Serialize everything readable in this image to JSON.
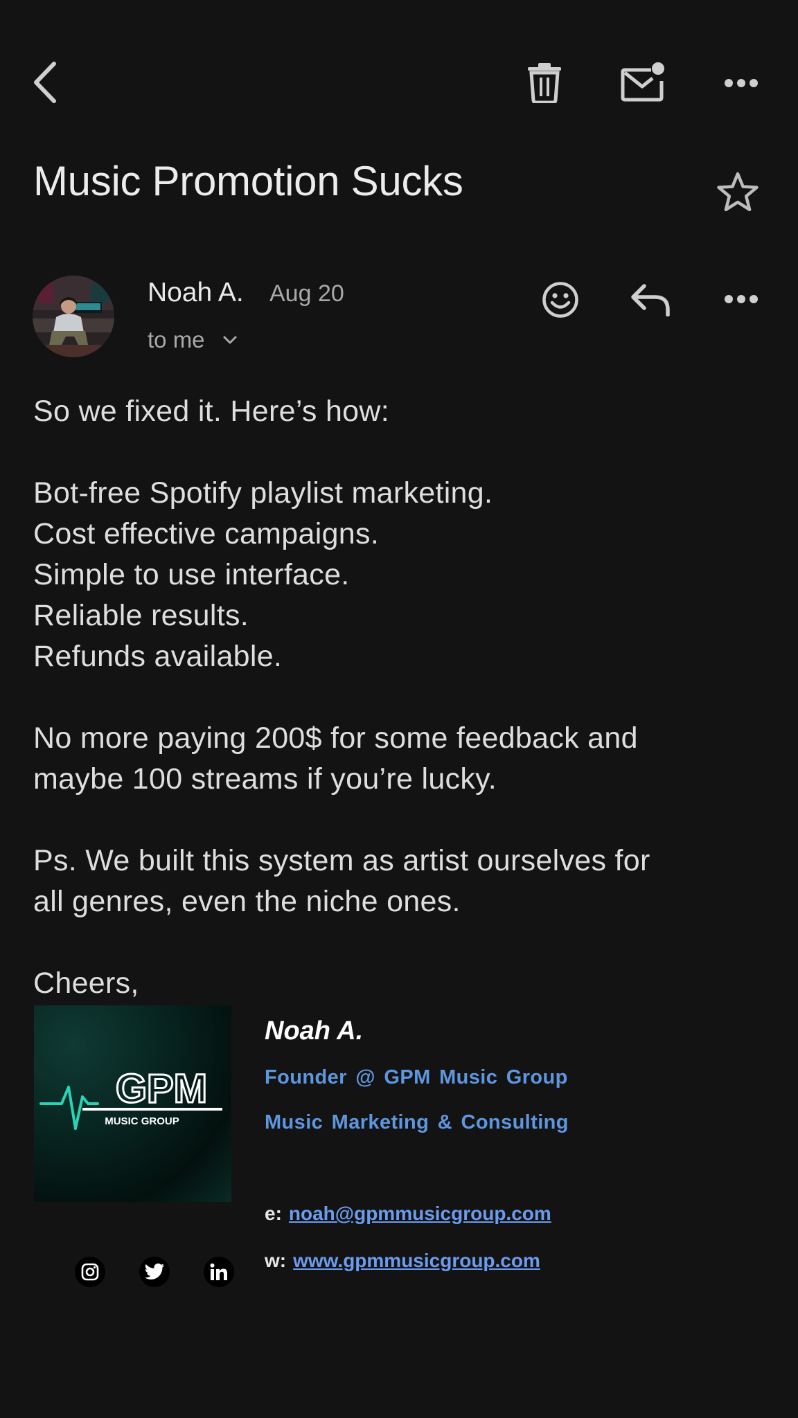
{
  "email": {
    "subject": "Music Promotion Sucks",
    "sender": {
      "name": "Noah A.",
      "date": "Aug 20",
      "recipient_label": "to me"
    },
    "body": {
      "intro": "So we fixed it. Here’s how:",
      "points": [
        "Bot-free Spotify playlist marketing.",
        "Cost effective campaigns.",
        "Simple to use interface.",
        "Reliable results.",
        "Refunds available."
      ],
      "para2_line1": "No more paying 200$ for some feedback and",
      "para2_line2": "maybe 100 streams if you’re lucky.",
      "para3_line1": "Ps. We built this system as artist ourselves for",
      "para3_line2": "all genres, even the niche ones.",
      "signoff": "Cheers,"
    },
    "signature": {
      "logo_main": "GPM",
      "logo_sub": "MUSIC GROUP",
      "name": "Noah A.",
      "title": "Founder @ GPM Music Group",
      "tagline": "Music Marketing & Consulting",
      "email_label": "e:",
      "email": "noah@gpmmusicgroup.com",
      "web_label": "w:",
      "website": "www.gpmmusicgroup.com",
      "socials": [
        "instagram-icon",
        "twitter-icon",
        "linkedin-icon"
      ]
    }
  },
  "colors": {
    "background": "#131313",
    "link": "#6c9cf0",
    "signature_accent": "#5e97e0",
    "logo_teal": "#29d3b6"
  }
}
